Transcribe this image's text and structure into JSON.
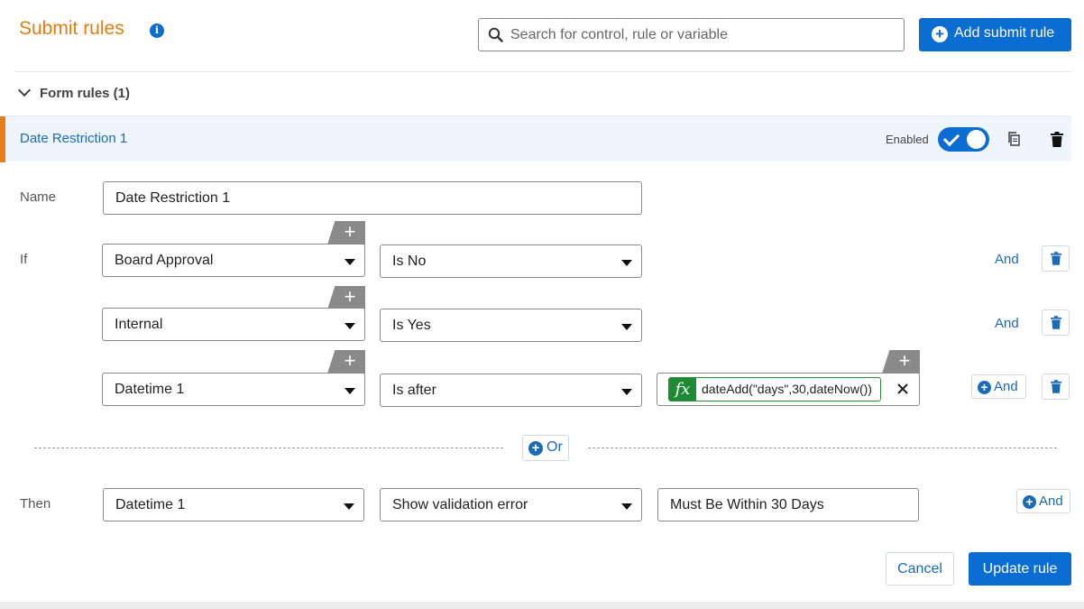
{
  "header": {
    "title": "Submit rules",
    "info_icon": "info-icon",
    "search_placeholder": "Search for control, rule or variable",
    "add_button": "Add submit rule"
  },
  "section": {
    "label": "Form rules (1)"
  },
  "rule": {
    "name": "Date Restriction 1",
    "enabled_label": "Enabled",
    "enabled": true
  },
  "form": {
    "name_label": "Name",
    "name_value": "Date Restriction 1",
    "if_label": "If",
    "conditions": [
      {
        "field": "Board Approval",
        "operator": "Is No",
        "value": "",
        "connector": "And"
      },
      {
        "field": "Internal",
        "operator": "Is Yes",
        "value": "",
        "connector": "And"
      },
      {
        "field": "Datetime 1",
        "operator": "Is after",
        "value_fx": "fx",
        "value": "dateAdd(\"days\",30,dateNow())",
        "connector": "And"
      }
    ],
    "or_label": "Or",
    "then_label": "Then",
    "action": {
      "field": "Datetime 1",
      "action": "Show validation error",
      "message": "Must Be Within 30 Days",
      "connector": "And"
    }
  },
  "footer": {
    "cancel": "Cancel",
    "update": "Update rule"
  },
  "colors": {
    "accent_orange": "#e07d10",
    "primary_blue": "#0b6cd1",
    "link_blue": "#1b6ab5",
    "fx_green": "#1e8b34"
  }
}
